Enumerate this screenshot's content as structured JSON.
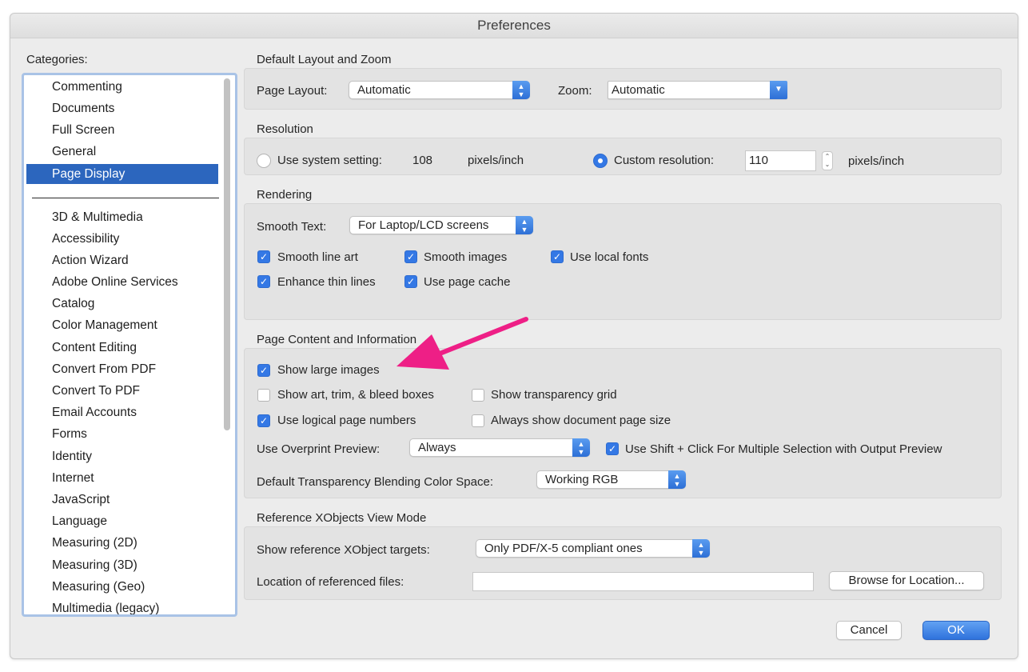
{
  "window": {
    "title": "Preferences"
  },
  "categories": {
    "label": "Categories:",
    "selected": "Page Display",
    "group1": [
      "Commenting",
      "Documents",
      "Full Screen",
      "General",
      "Page Display"
    ],
    "group2": [
      "3D & Multimedia",
      "Accessibility",
      "Action Wizard",
      "Adobe Online Services",
      "Catalog",
      "Color Management",
      "Content Editing",
      "Convert From PDF",
      "Convert To PDF",
      "Email Accounts",
      "Forms",
      "Identity",
      "Internet",
      "JavaScript",
      "Language",
      "Measuring (2D)",
      "Measuring (3D)",
      "Measuring (Geo)",
      "Multimedia (legacy)"
    ]
  },
  "layout_zoom": {
    "title": "Default Layout and Zoom",
    "page_layout_label": "Page Layout:",
    "page_layout_value": "Automatic",
    "zoom_label": "Zoom:",
    "zoom_value": "Automatic"
  },
  "resolution": {
    "title": "Resolution",
    "system_label": "Use system setting:",
    "system_value": "108",
    "system_unit": "pixels/inch",
    "custom_label": "Custom resolution:",
    "custom_value": "110",
    "custom_unit": "pixels/inch",
    "selected": "custom"
  },
  "rendering": {
    "title": "Rendering",
    "smooth_text_label": "Smooth Text:",
    "smooth_text_value": "For Laptop/LCD screens",
    "smooth_line_art": "Smooth line art",
    "smooth_images": "Smooth images",
    "use_local_fonts": "Use local fonts",
    "enhance_thin_lines": "Enhance thin lines",
    "use_page_cache": "Use page cache"
  },
  "page_content": {
    "title": "Page Content and Information",
    "show_large_images": "Show large images",
    "show_boxes": "Show art, trim, & bleed boxes",
    "show_transparency_grid": "Show transparency grid",
    "use_logical_page_numbers": "Use logical page numbers",
    "always_show_page_size": "Always show document page size",
    "overprint_label": "Use Overprint Preview:",
    "overprint_value": "Always",
    "shift_click": "Use Shift + Click For Multiple Selection with Output Preview",
    "blending_label": "Default Transparency Blending Color Space:",
    "blending_value": "Working RGB"
  },
  "xobjects": {
    "title": "Reference XObjects View Mode",
    "targets_label": "Show reference XObject targets:",
    "targets_value": "Only PDF/X-5 compliant ones",
    "location_label": "Location of referenced files:",
    "location_value": "",
    "browse_button": "Browse for Location..."
  },
  "buttons": {
    "cancel": "Cancel",
    "ok": "OK"
  },
  "colors": {
    "accent": "#3478e5",
    "selection": "#2c66be",
    "annotation_arrow": "#ee1f86"
  },
  "checkmark_glyph": "✓"
}
